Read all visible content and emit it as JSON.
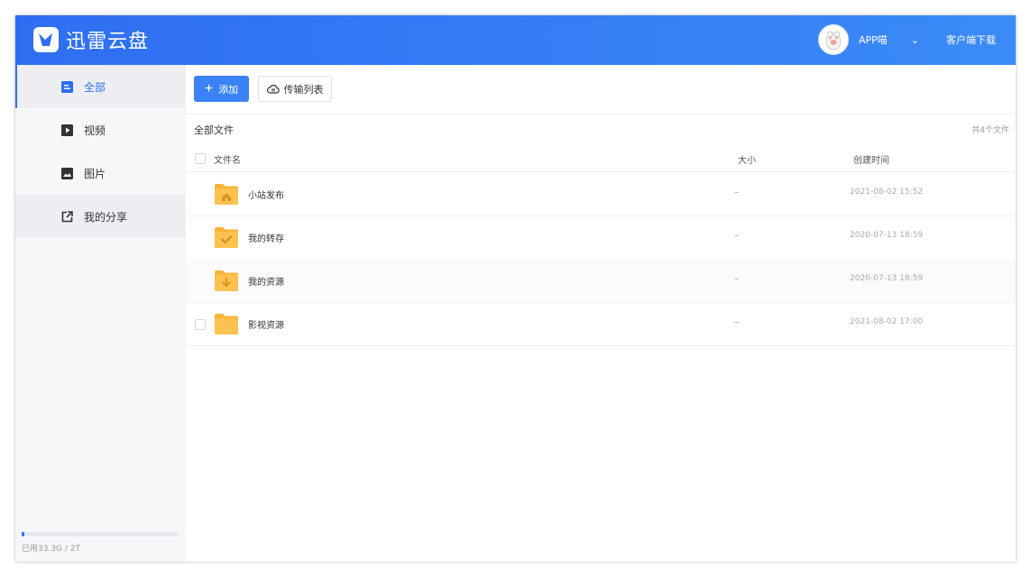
{
  "app": {
    "brand": "迅雷云盘"
  },
  "header": {
    "username": "APP喵",
    "client_download": "客户端下载",
    "caret": "⌄"
  },
  "sidebar": {
    "items": [
      {
        "label": "全部",
        "icon": "list-icon"
      },
      {
        "label": "视频",
        "icon": "video-icon"
      },
      {
        "label": "图片",
        "icon": "image-icon"
      },
      {
        "label": "我的分享",
        "icon": "share-icon"
      }
    ],
    "storage": {
      "text": "已用33.3G / 2T",
      "used_fraction": 0.017
    }
  },
  "toolbar": {
    "add_label": "添加",
    "transfer_label": "传输列表"
  },
  "breadcrumb": "全部文件",
  "file_count": "共4个文件",
  "table": {
    "headers": {
      "name": "文件名",
      "size": "大小",
      "time": "创建时间"
    },
    "rows": [
      {
        "name": "小站发布",
        "size": "–",
        "time": "2021-08-02 15:52",
        "badge": "home"
      },
      {
        "name": "我的转存",
        "size": "–",
        "time": "2020-07-13 18:59",
        "badge": "check"
      },
      {
        "name": "我的资源",
        "size": "–",
        "time": "2020-07-13 18:59",
        "badge": "download"
      },
      {
        "name": "影视资源",
        "size": "–",
        "time": "2021-08-02 17:00",
        "badge": "none"
      }
    ]
  },
  "colors": {
    "brand": "#2f6ef2",
    "folder": "#f8b43a"
  }
}
